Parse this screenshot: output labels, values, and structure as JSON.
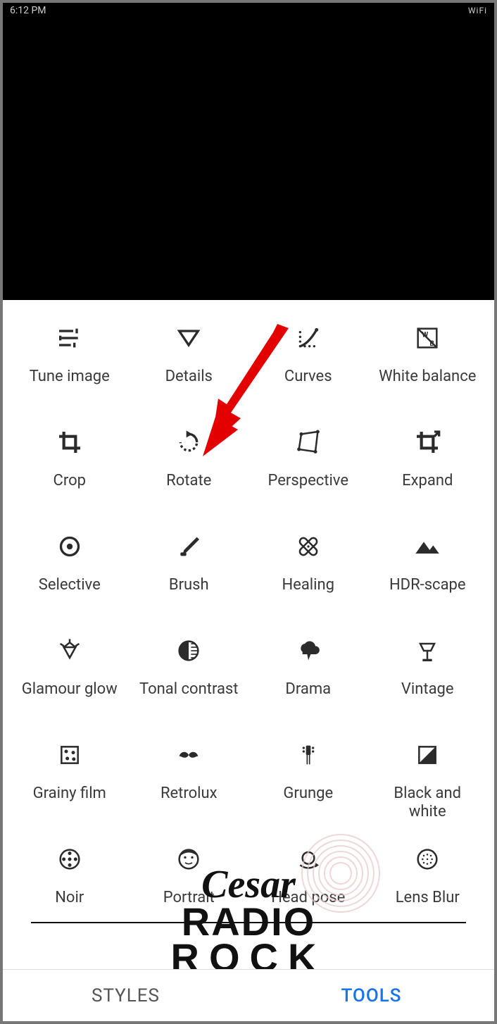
{
  "status": {
    "time": "6:12 PM",
    "wifi": "WiFi"
  },
  "tools": [
    {
      "id": "tune-image",
      "label": "Tune image",
      "icon": "sliders"
    },
    {
      "id": "details",
      "label": "Details",
      "icon": "triangle-down"
    },
    {
      "id": "curves",
      "label": "Curves",
      "icon": "curves"
    },
    {
      "id": "white-balance",
      "label": "White balance",
      "icon": "wb"
    },
    {
      "id": "crop",
      "label": "Crop",
      "icon": "crop"
    },
    {
      "id": "rotate",
      "label": "Rotate",
      "icon": "rotate"
    },
    {
      "id": "perspective",
      "label": "Perspective",
      "icon": "perspective"
    },
    {
      "id": "expand",
      "label": "Expand",
      "icon": "expand"
    },
    {
      "id": "selective",
      "label": "Selective",
      "icon": "target"
    },
    {
      "id": "brush",
      "label": "Brush",
      "icon": "brush"
    },
    {
      "id": "healing",
      "label": "Healing",
      "icon": "bandage"
    },
    {
      "id": "hdr-scape",
      "label": "HDR-scape",
      "icon": "mountains"
    },
    {
      "id": "glamour-glow",
      "label": "Glamour glow",
      "icon": "diamond-shine"
    },
    {
      "id": "tonal-contrast",
      "label": "Tonal contrast",
      "icon": "half-circle"
    },
    {
      "id": "drama",
      "label": "Drama",
      "icon": "cloud-bolt"
    },
    {
      "id": "vintage",
      "label": "Vintage",
      "icon": "lamp"
    },
    {
      "id": "grainy-film",
      "label": "Grainy film",
      "icon": "film-dots"
    },
    {
      "id": "retrolux",
      "label": "Retrolux",
      "icon": "mustache"
    },
    {
      "id": "grunge",
      "label": "Grunge",
      "icon": "guitar-head"
    },
    {
      "id": "black-and-white",
      "label": "Black and white",
      "icon": "bw-square"
    },
    {
      "id": "noir",
      "label": "Noir",
      "icon": "reel"
    },
    {
      "id": "portrait",
      "label": "Portrait",
      "icon": "face"
    },
    {
      "id": "head-pose",
      "label": "Head pose",
      "icon": "head-rotate"
    },
    {
      "id": "lens-blur",
      "label": "Lens Blur",
      "icon": "blur-circle"
    }
  ],
  "tabs": {
    "styles": "STYLES",
    "tools": "TOOLS",
    "active": "tools"
  },
  "annotation": {
    "arrow_target": "rotate"
  },
  "watermark": {
    "line1": "Cesar",
    "line2": "RADIO",
    "line3": "ROCK"
  }
}
